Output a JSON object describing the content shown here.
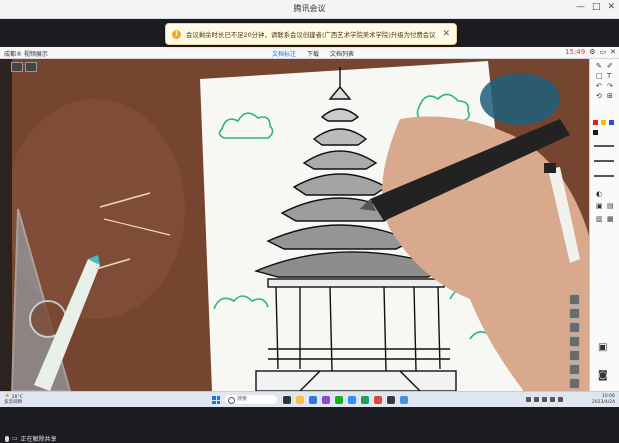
{
  "window": {
    "title": "腾讯会议",
    "controls": [
      "—",
      "□",
      "✕"
    ]
  },
  "notice": {
    "text": "会议剩余时长已不足20分钟，请联系会议创建者(广西艺术学院美术学院)升级为付费会议。"
  },
  "share_bar": {
    "left_label": "成都® 视频展示",
    "tabs": [
      "文档标注",
      "下载",
      "文档列表"
    ],
    "timer": "15:49"
  },
  "toolbar": {
    "tools": [
      "✎",
      "✐",
      "□",
      "T",
      "↶",
      "↷",
      "⟲",
      "⊞"
    ],
    "colors": [
      "#e02020",
      "#f2c200",
      "#2050e0",
      "#1a1a1a"
    ]
  },
  "taskbar": {
    "weather_temp": "28°C",
    "weather_desc": "多云间晴",
    "search_placeholder": "搜索",
    "time": "10:06",
    "date": "2023/4/24"
  },
  "bottom": {
    "status": "正在解除共享"
  }
}
